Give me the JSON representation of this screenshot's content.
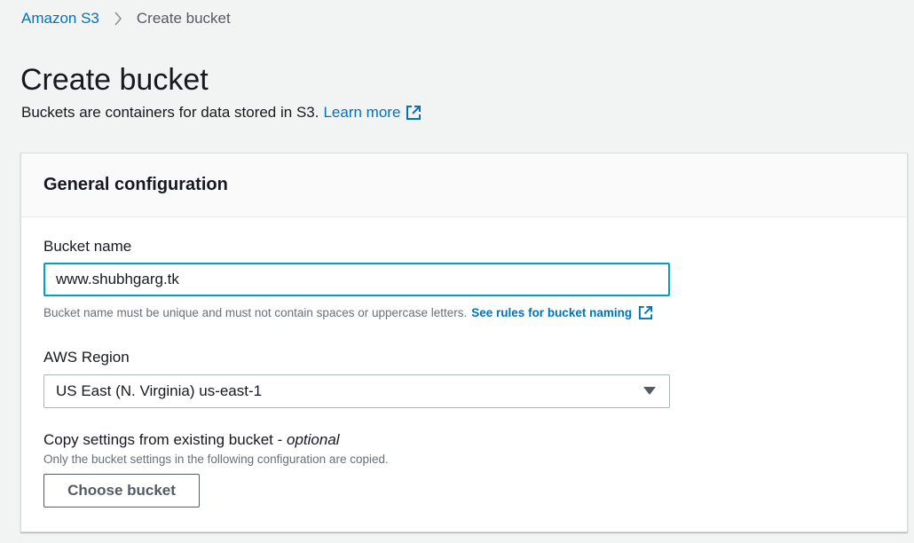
{
  "breadcrumb": {
    "root": "Amazon S3",
    "current": "Create bucket"
  },
  "page": {
    "title": "Create bucket",
    "description": "Buckets are containers for data stored in S3.",
    "learn_more": "Learn more"
  },
  "general_config": {
    "title": "General configuration",
    "bucket_name": {
      "label": "Bucket name",
      "value": "www.shubhgarg.tk",
      "hint": "Bucket name must be unique and must not contain spaces or uppercase letters.",
      "rules_link": "See rules for bucket naming"
    },
    "region": {
      "label": "AWS Region",
      "selected": "US East (N. Virginia) us-east-1"
    },
    "copy_settings": {
      "label": "Copy settings from existing bucket - ",
      "optional": "optional",
      "hint": "Only the bucket settings in the following configuration are copied.",
      "button": "Choose bucket"
    }
  },
  "icons": {
    "breadcrumb_separator": "chevron-right-icon",
    "external_link": "external-link-icon",
    "dropdown": "caret-down-icon"
  },
  "colors": {
    "link": "#0073bb",
    "focus_border": "#00a1c9",
    "background": "#f2f3f3",
    "text": "#16191f",
    "muted": "#687078"
  }
}
